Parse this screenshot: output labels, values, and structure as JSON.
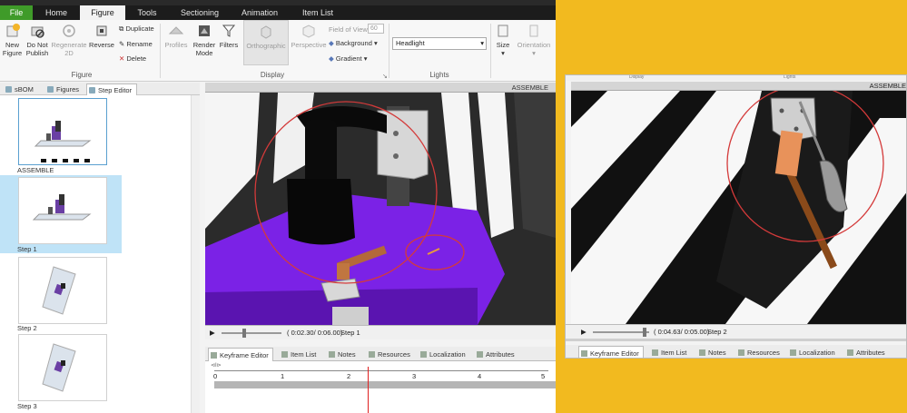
{
  "menu": {
    "tabs": [
      "File",
      "Home",
      "Figure",
      "Tools",
      "Sectioning",
      "Animation",
      "Item List"
    ],
    "active": "Figure"
  },
  "ribbon": {
    "figure_group": {
      "label": "Figure",
      "new_figure": "New Figure",
      "do_not_publish": "Do Not Publish",
      "regenerate_2d": "Regenerate 2D",
      "reverse": "Reverse",
      "duplicate": "Duplicate",
      "rename": "Rename",
      "delete": "Delete"
    },
    "display_group": {
      "label": "Display",
      "profiles": "Profiles",
      "render_mode": "Render Mode",
      "filters": "Filters",
      "orthographic": "Orthographic",
      "perspective": "Perspective",
      "field_of_view_label": "Field of View",
      "field_of_view_value": "60",
      "background": "Background",
      "gradient": "Gradient"
    },
    "lights_group": {
      "label": "Lights",
      "headlight_value": "Headlight"
    },
    "size": "Size",
    "orientation": "Orientation"
  },
  "panel": {
    "tabs": [
      "sBOM",
      "Figures",
      "Step Editor"
    ],
    "active_tab": "Step Editor",
    "steps": [
      {
        "label": "ASSEMBLE"
      },
      {
        "label": "Step 1"
      },
      {
        "label": "Step 2"
      },
      {
        "label": "Step 3"
      }
    ]
  },
  "viewport": {
    "title": "ASSEMBLE",
    "time_display": "( 0:02.30/ 0:06.00)",
    "step_label": "Step 1",
    "slider_fraction": 0.38
  },
  "bottom_tabs": [
    "Keyframe Editor",
    "Item List",
    "Notes",
    "Resources",
    "Localization",
    "Attributes"
  ],
  "keyframe": {
    "ticks": [
      "0",
      "1",
      "2",
      "3",
      "4",
      "5"
    ],
    "playhead_fraction": 0.46
  },
  "secondary": {
    "title": "ASSEMBLE",
    "time_display": "( 0:04.63/ 0:05.00)",
    "step_label": "Step 2",
    "slider_fraction": 0.92,
    "partial_headers": [
      "Display",
      "Lights"
    ],
    "bottom_tabs": [
      "Keyframe Editor",
      "Item List",
      "Notes",
      "Resources",
      "Localization",
      "Attributes"
    ]
  },
  "colors": {
    "accent_green": "#3f9b29",
    "background_yellow": "#f2ba1f",
    "platform_purple": "#7b22e6",
    "highlight_circle": "#d43a3a",
    "selected_step": "#bfe3f7"
  }
}
